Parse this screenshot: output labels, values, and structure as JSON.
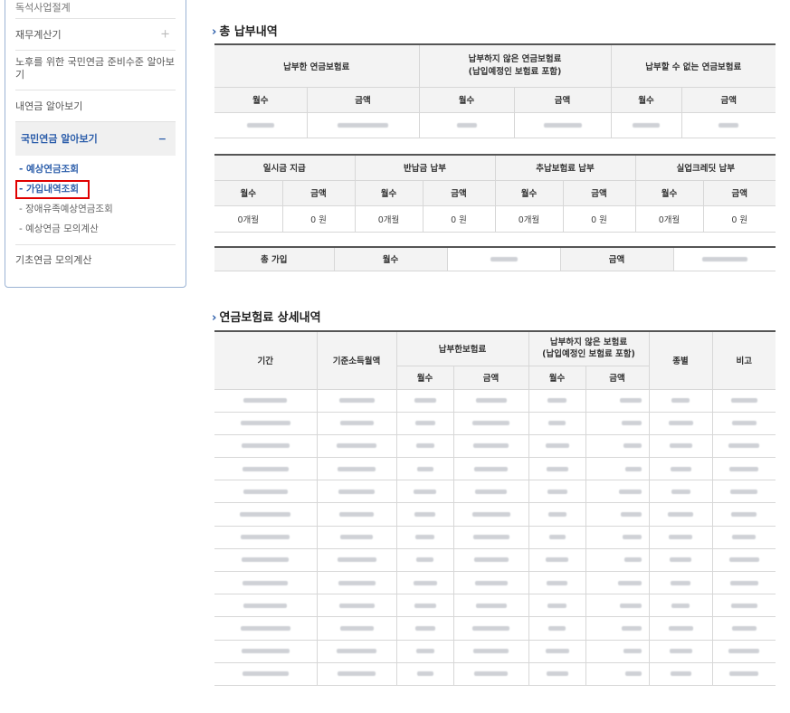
{
  "sidebar": {
    "top_item": "독석사업절계",
    "finance_calc": "재무계산기",
    "retirement_plan": "노후를 위한 국민연금 준비수준 알아보기",
    "my_pension": "내연금 알아보기",
    "npn_section": "국민연금 알아보기",
    "sub_items": [
      "- 예상연금조회",
      "- 가입내역조회",
      "- 장애유족예상연금조회",
      "- 예상연금 모의계산"
    ],
    "basic_pension": "기초연금 모의계산",
    "plus_icon": "+",
    "minus_icon": "−"
  },
  "total_payment": {
    "title": "총 납부내역",
    "group_paid": "납부한 연금보험료",
    "group_unpaid": "납부하지 않은 연금보험료\n(납입예정인 보험료 포함)",
    "group_cannot": "납부할 수 없는 연금보험료",
    "col_months": "월수",
    "col_amount": "금액"
  },
  "extra_payment": {
    "group_lump": "일시금 지급",
    "group_return": "반납금 납부",
    "group_add": "추납보험료 납부",
    "group_unemp": "실업크레딧 납부",
    "col_months": "월수",
    "col_amount": "금액",
    "values": [
      "0개월",
      "0 원",
      "0개월",
      "0 원",
      "0개월",
      "0 원",
      "0개월",
      "0 원"
    ]
  },
  "total_join": {
    "label": "총 가입",
    "col_months": "월수",
    "col_amount": "금액"
  },
  "detail": {
    "title": "연금보험료 상세내역",
    "col_period": "기간",
    "col_base_income": "기준소득월액",
    "group_paid": "납부한보험료",
    "group_unpaid": "납부하지 않은 보험료\n(납입예정인 보험료 포함)",
    "col_type": "종별",
    "col_note": "비고",
    "col_months": "월수",
    "col_amount": "금액"
  },
  "colors": {
    "accent": "#2b5daa",
    "highlight_box": "#e00000"
  }
}
